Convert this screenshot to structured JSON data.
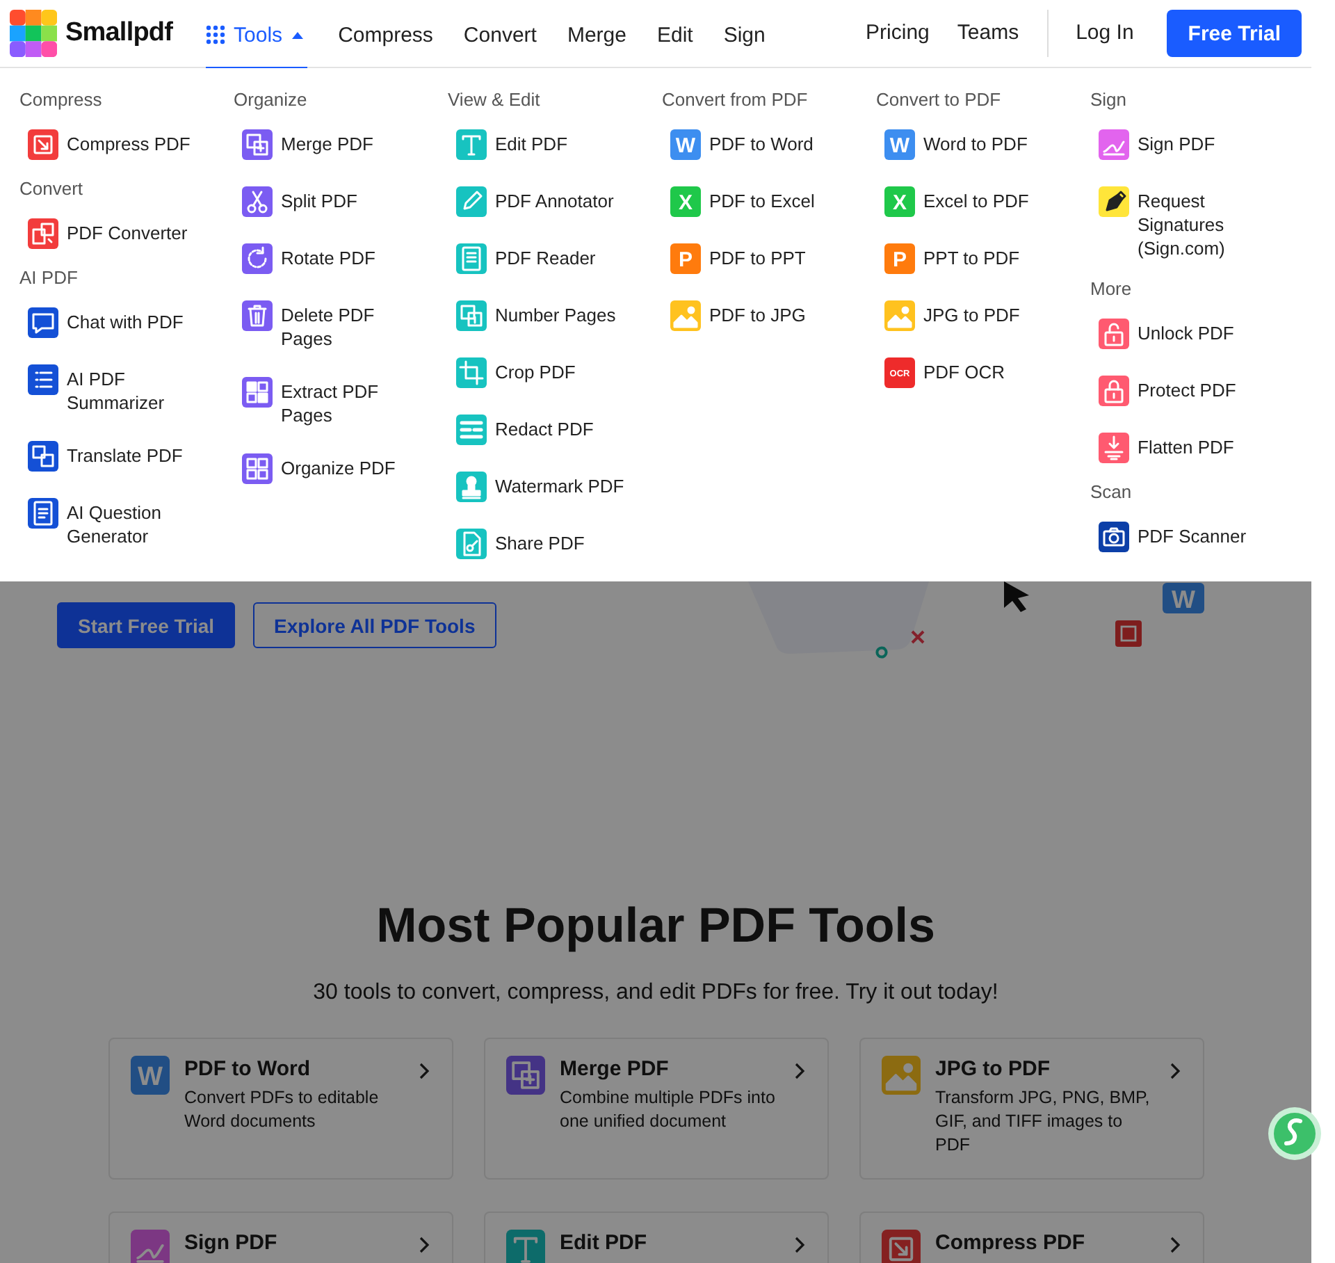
{
  "header": {
    "brand": "Smallpdf",
    "nav": [
      {
        "label": "Tools",
        "selected": true,
        "expanded": true,
        "kind": "menu"
      },
      {
        "label": "Compress",
        "selected": false,
        "kind": "link"
      },
      {
        "label": "Convert",
        "selected": false,
        "kind": "link"
      },
      {
        "label": "Merge",
        "selected": false,
        "kind": "link"
      },
      {
        "label": "Edit",
        "selected": false,
        "kind": "link"
      },
      {
        "label": "Sign",
        "selected": false,
        "kind": "link"
      }
    ],
    "links": [
      "Pricing",
      "Teams"
    ],
    "login": "Log In",
    "cta": "Free Trial"
  },
  "menu": {
    "columns": [
      {
        "sections": [
          {
            "heading": "Compress",
            "items": [
              {
                "label": "Compress PDF",
                "kind": "compress",
                "color": "#f23c3c"
              }
            ]
          },
          {
            "heading": "Convert",
            "items": [
              {
                "label": "PDF Converter",
                "kind": "convert",
                "color": "#f23c3c"
              }
            ]
          },
          {
            "heading": "AI PDF",
            "items": [
              {
                "label": "Chat with PDF",
                "kind": "chat",
                "color": "#1450d6"
              },
              {
                "label": "AI PDF Summarizer",
                "kind": "list",
                "color": "#1450d6"
              },
              {
                "label": "Translate PDF",
                "kind": "translate",
                "color": "#1450d6"
              },
              {
                "label": "AI Question Generator",
                "kind": "question",
                "color": "#1450d6"
              }
            ]
          }
        ]
      },
      {
        "sections": [
          {
            "heading": "Organize",
            "items": [
              {
                "label": "Merge PDF",
                "kind": "merge",
                "color": "#7b5cf2"
              },
              {
                "label": "Split PDF",
                "kind": "split",
                "color": "#7b5cf2"
              },
              {
                "label": "Rotate PDF",
                "kind": "rotate",
                "color": "#7b5cf2"
              },
              {
                "label": "Delete PDF Pages",
                "kind": "delete",
                "color": "#7b5cf2"
              },
              {
                "label": "Extract PDF Pages",
                "kind": "extract",
                "color": "#7b5cf2"
              },
              {
                "label": "Organize PDF",
                "kind": "organize",
                "color": "#7b5cf2"
              }
            ]
          }
        ]
      },
      {
        "sections": [
          {
            "heading": "View & Edit",
            "items": [
              {
                "label": "Edit PDF",
                "kind": "edit",
                "color": "#17c3c0"
              },
              {
                "label": "PDF Annotator",
                "kind": "annotate",
                "color": "#17c3c0"
              },
              {
                "label": "PDF Reader",
                "kind": "reader",
                "color": "#17c3c0"
              },
              {
                "label": "Number Pages",
                "kind": "number",
                "color": "#17c3c0"
              },
              {
                "label": "Crop PDF",
                "kind": "crop",
                "color": "#17c3c0"
              },
              {
                "label": "Redact PDF",
                "kind": "redact",
                "color": "#17c3c0"
              },
              {
                "label": "Watermark PDF",
                "kind": "watermark",
                "color": "#17c3c0"
              },
              {
                "label": "Share PDF",
                "kind": "share",
                "color": "#17c3c0"
              }
            ]
          }
        ]
      },
      {
        "sections": [
          {
            "heading": "Convert from PDF",
            "items": [
              {
                "label": "PDF to Word",
                "kind": "letter",
                "glyph": "W",
                "color": "#3d8ef0"
              },
              {
                "label": "PDF to Excel",
                "kind": "letter",
                "glyph": "X",
                "color": "#1fc84a"
              },
              {
                "label": "PDF to PPT",
                "kind": "letter",
                "glyph": "P",
                "color": "#ff7b0d"
              },
              {
                "label": "PDF to JPG",
                "kind": "image",
                "color": "#ffc21f"
              }
            ]
          }
        ]
      },
      {
        "sections": [
          {
            "heading": "Convert to PDF",
            "items": [
              {
                "label": "Word to PDF",
                "kind": "letter",
                "glyph": "W",
                "color": "#3d8ef0"
              },
              {
                "label": "Excel to PDF",
                "kind": "letter",
                "glyph": "X",
                "color": "#1fc84a"
              },
              {
                "label": "PPT to PDF",
                "kind": "letter",
                "glyph": "P",
                "color": "#ff7b0d"
              },
              {
                "label": "JPG to PDF",
                "kind": "image",
                "color": "#ffc21f"
              },
              {
                "label": "PDF OCR",
                "kind": "letter",
                "glyph": "OCR",
                "color": "#ee2b2b"
              }
            ]
          }
        ]
      },
      {
        "sections": [
          {
            "heading": "Sign",
            "items": [
              {
                "label": "Sign PDF",
                "kind": "sign",
                "color": "#e264ee"
              },
              {
                "label": "Request Signatures (Sign.com)",
                "kind": "pen",
                "color": "#ffe53a"
              }
            ]
          },
          {
            "heading": "More",
            "items": [
              {
                "label": "Unlock PDF",
                "kind": "unlock",
                "color": "#ff5a70"
              },
              {
                "label": "Protect PDF",
                "kind": "protect",
                "color": "#ff5a70"
              },
              {
                "label": "Flatten PDF",
                "kind": "flatten",
                "color": "#ff5a70"
              }
            ]
          },
          {
            "heading": "Scan",
            "items": [
              {
                "label": "PDF Scanner",
                "kind": "scan",
                "color": "#0c3fa8"
              }
            ]
          }
        ]
      }
    ]
  },
  "hero": {
    "primary": "Start Free Trial",
    "secondary": "Explore All PDF Tools",
    "badge_glyph": "W"
  },
  "popular": {
    "title": "Most Popular PDF Tools",
    "subtitle": "30 tools to convert, compress, and edit PDFs for free. Try it out today!",
    "cards": [
      {
        "title": "PDF to Word",
        "description": "Convert PDFs to editable Word documents",
        "kind": "letter",
        "glyph": "W",
        "color": "#214e84"
      },
      {
        "title": "Merge PDF",
        "description": "Combine multiple PDFs into one unified document",
        "kind": "merge",
        "color": "#443385"
      },
      {
        "title": "JPG to PDF",
        "description": "Transform JPG, PNG, BMP, GIF, and TIFF images to PDF",
        "kind": "image",
        "color": "#8c6b11"
      },
      {
        "title": "Sign PDF",
        "kind": "sign",
        "color": "#7c3783"
      },
      {
        "title": "Edit PDF",
        "kind": "edit",
        "color": "#0d6b6a"
      },
      {
        "title": "Compress PDF",
        "kind": "compress",
        "color": "#852121"
      }
    ]
  }
}
